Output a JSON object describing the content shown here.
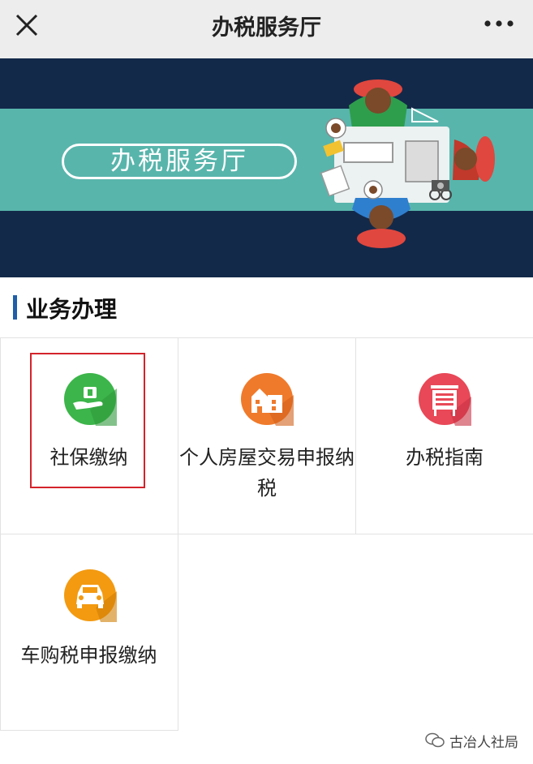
{
  "nav": {
    "title": "办税服务厅",
    "close_icon": "close-icon",
    "more_icon": "more-dots-icon"
  },
  "banner": {
    "title": "办税服务厅",
    "colors": {
      "background": "#13294a",
      "stripe": "#58b5ac"
    }
  },
  "section": {
    "title": "业务办理",
    "accent": "#1f5fa8"
  },
  "services": [
    {
      "label": "社保缴纳",
      "icon": "hand-money-icon",
      "color": "#3cb54a",
      "highlighted": true
    },
    {
      "label": "个人房屋交易申报纳税",
      "icon": "house-icon",
      "color": "#ef7a2b",
      "highlighted": false
    },
    {
      "label": "办税指南",
      "icon": "guide-board-icon",
      "color": "#e84857",
      "highlighted": false
    },
    {
      "label": "车购税申报缴纳",
      "icon": "car-icon",
      "color": "#f39a11",
      "highlighted": false
    }
  ],
  "footer": {
    "account": "古冶人社局",
    "icon": "wechat-icon"
  }
}
